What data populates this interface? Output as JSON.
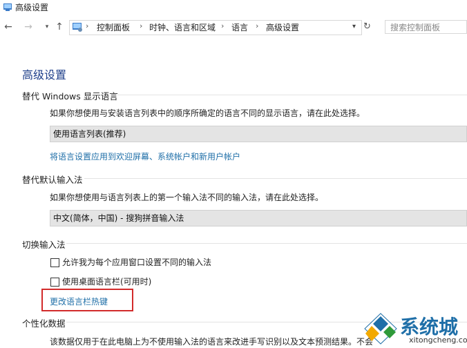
{
  "window": {
    "title": "高级设置"
  },
  "address": {
    "crumbs": [
      "控制面板",
      "时钟、语言和区域",
      "语言",
      "高级设置"
    ],
    "separator": "›"
  },
  "search": {
    "placeholder": "搜索控制面板"
  },
  "page": {
    "title": "高级设置"
  },
  "display_language": {
    "heading": "替代 Windows 显示语言",
    "description": "如果你想使用与安装语言列表中的顺序所确定的语言不同的显示语言，请在此处选择。",
    "selected": "使用语言列表(推荐)",
    "apply_link": "将语言设置应用到欢迎屏幕、系统帐户和新用户帐户"
  },
  "input_method": {
    "heading": "替代默认输入法",
    "description": "如果你想使用与语言列表上的第一个输入法不同的输入法，请在此处选择。",
    "selected": "中文(简体，中国) - 搜狗拼音输入法"
  },
  "switch_input": {
    "heading": "切换输入法",
    "checkbox1": {
      "label": "允许我为每个应用窗口设置不同的输入法",
      "checked": false
    },
    "checkbox2": {
      "label": "使用桌面语言栏(可用时)",
      "checked": false
    },
    "hotkey_link": "更改语言栏热键"
  },
  "personalization": {
    "heading": "个性化数据",
    "description": "该数据仅用于在此电脑上为不使用输入法的语言来改进手写识别以及文本预测结果。不会"
  },
  "watermark": {
    "name": "系统城",
    "url": "xitongcheng.com"
  },
  "colors": {
    "accent_link": "#1f6fa8",
    "highlight_box": "#d22a2a",
    "title": "#1e3f8a"
  }
}
